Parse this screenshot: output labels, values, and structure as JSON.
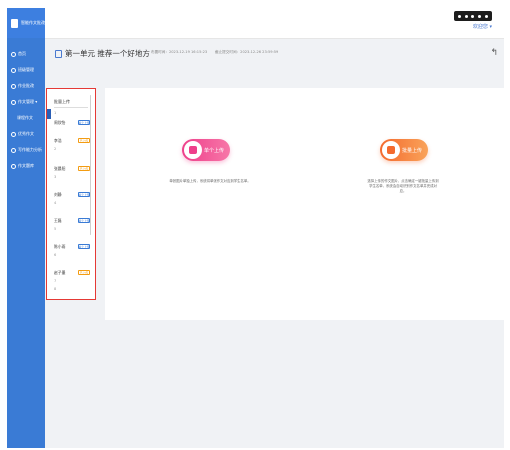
{
  "topbar": {
    "brand_title": "智能作文批改",
    "user_name": "欢迎您 ▾"
  },
  "sidebar": {
    "items": [
      {
        "label": "首页"
      },
      {
        "label": "班级管理"
      },
      {
        "label": "作业批改"
      },
      {
        "label": "作文管理 ▾"
      },
      {
        "label": "课程作文",
        "sub": true
      },
      {
        "label": "优秀作文"
      },
      {
        "label": "写作能力分析"
      },
      {
        "label": "作文题库"
      }
    ]
  },
  "header": {
    "title": "第一单元 推荐一个好地方",
    "created_label": "布置时间：2023-12-19 16:15:23",
    "deadline_label": "截止提交时间：2023-12-26 23:59:59"
  },
  "left_panel": {
    "heading": "批量上传",
    "rows": [
      {
        "index": "1",
        "name": "周欣怡",
        "action": "单个上传",
        "style": "blue"
      },
      {
        "index": "2",
        "name": "李浩",
        "action": "已上传",
        "style": "orange"
      },
      {
        "index": "3",
        "name": "张晨阳",
        "action": "已上传",
        "style": "orange"
      },
      {
        "index": "4",
        "name": "刘静",
        "action": "单个上传",
        "style": "blue"
      },
      {
        "index": "5",
        "name": "王磊",
        "action": "单个上传",
        "style": "blue"
      },
      {
        "index": "6",
        "name": "陈小雨",
        "action": "单个上传",
        "style": "blue"
      },
      {
        "index": "7",
        "name": "赵子墨",
        "action": "已上传",
        "style": "orange"
      },
      {
        "index": "8",
        "name": "",
        "action": "",
        "style": ""
      }
    ]
  },
  "single_upload": {
    "label": "单个上传",
    "description": "单张图片单独上传，系统将单张作文对应到学生名单。"
  },
  "batch_upload": {
    "label": "批量上传",
    "description": "选择上传的作文图片，点击确定一键批量上传到学生名单，系统会自动识别作文名单并完成对应。"
  },
  "colors": {
    "sidebar": "#3a7bd5",
    "single_button": "#ee3f8b",
    "batch_button": "#f46a2e",
    "highlight_border": "#e53935"
  }
}
